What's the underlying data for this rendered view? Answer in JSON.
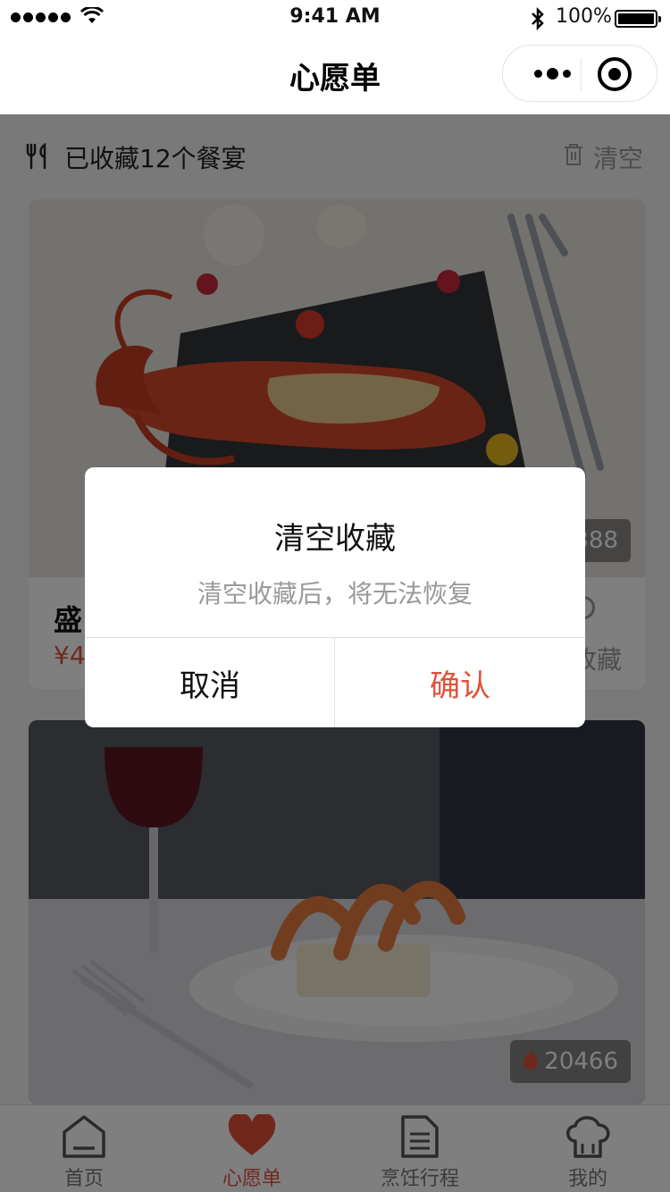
{
  "status_bar": {
    "time": "9:41 AM",
    "battery": "100%"
  },
  "nav": {
    "title": "心愿单"
  },
  "summary": {
    "count_text": "已收藏12个餐宴",
    "clear_label": "清空"
  },
  "cards": [
    {
      "name": "盛",
      "price": "¥4",
      "hot_count": "388",
      "fav_label": "收藏"
    },
    {
      "hot_count": "20466"
    }
  ],
  "tabbar": {
    "items": [
      {
        "label": "首页",
        "icon": "home-icon"
      },
      {
        "label": "心愿单",
        "icon": "heart-icon",
        "active": true
      },
      {
        "label": "烹饪行程",
        "icon": "document-icon"
      },
      {
        "label": "我的",
        "icon": "chef-hat-icon"
      }
    ]
  },
  "modal": {
    "title": "清空收藏",
    "content": "清空收藏后，将无法恢复",
    "cancel_label": "取消",
    "confirm_label": "确认"
  },
  "colors": {
    "accent": "#e0513a",
    "mask": "rgba(0,0,0,0.5)"
  }
}
